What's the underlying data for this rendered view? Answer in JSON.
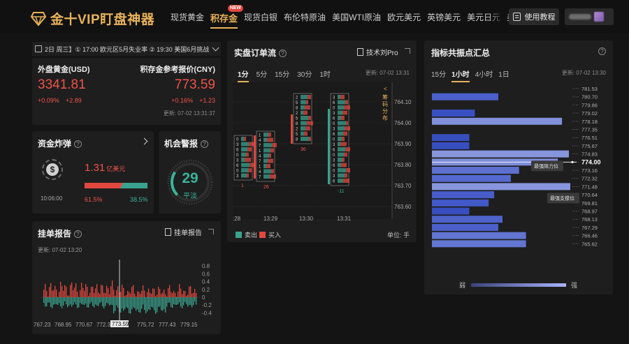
{
  "header": {
    "logo_text": "金十VIP盯盘神器",
    "nav": [
      {
        "label": "现货黄金",
        "active": false
      },
      {
        "label": "积存金",
        "active": true,
        "badge": "NEW"
      },
      {
        "label": "现货白银",
        "active": false
      },
      {
        "label": "布伦特原油",
        "active": false
      },
      {
        "label": "美国WTI原油",
        "active": false
      },
      {
        "label": "欧元美元",
        "active": false
      },
      {
        "label": "英镑美元",
        "active": false
      },
      {
        "label": "美元日元",
        "active": false
      },
      {
        "label": "美",
        "active": false
      }
    ],
    "tutorial_label": "使用教程"
  },
  "ticker": {
    "text": "2日 周三】① 17:00 欧元区5月失业率 ② 19:30 美国6月挑战"
  },
  "prices": {
    "left": {
      "label": "外盘黄金(USD)",
      "price": "3341.81",
      "change_pct": "+0.09%",
      "change": "+2.89"
    },
    "right": {
      "label": "积存金参考报价(CNY)",
      "price": "773.59",
      "change_pct": "+0.16%",
      "change": "+1.23"
    },
    "updated": "更新: 07-02 13:31:37"
  },
  "fund_bomb": {
    "title": "资金炸弹",
    "amount": "1.31",
    "unit": "亿美元",
    "time": "10:06:00",
    "sell_pct": "61.5%",
    "buy_pct": "38.5%",
    "sell_fraction": 0.615
  },
  "alert": {
    "title": "机会警报",
    "value": "29",
    "status": "平淡",
    "level_fraction": 0.29
  },
  "order_report": {
    "title": "挂单报告",
    "button_label": "挂单报告",
    "updated": "更新: 07-02 13:20",
    "x_labels": [
      "767.23",
      "768.95",
      "770.67",
      "772.39",
      "773.59",
      "775.72",
      "777.43",
      "779.15"
    ],
    "y_labels": [
      "0.8",
      "0.6",
      "0.4",
      "0.2",
      "0",
      "-0.2",
      "-0.4"
    ]
  },
  "order_flow": {
    "title": "实盘订单流",
    "pro_label": "技术刘Pro",
    "tabs": [
      "1分",
      "5分",
      "15分",
      "30分",
      "1时"
    ],
    "active_tab": "1分",
    "updated": "更新: 07-02 13:31",
    "side_label": "筹码分布",
    "price_levels": [
      "764.10",
      "764.00",
      "763.90",
      "763.80",
      "763.70",
      "763.60"
    ],
    "time_labels": [
      ":28",
      "13:29",
      "13:30",
      "13:31"
    ],
    "legend_sell": "卖出",
    "legend_buy": "买入",
    "unit_label": "单位: 手",
    "candle_labels": [
      "1",
      "26",
      "36",
      "-11"
    ],
    "colors": {
      "sell": "#3aa38f",
      "buy": "#e2483f"
    }
  },
  "resonance": {
    "title": "指标共振点汇总",
    "tabs": [
      "15分",
      "1小时",
      "4小时",
      "1日"
    ],
    "active_tab": "1小时",
    "updated": "更新: 07-02 13:30",
    "levels": [
      "781.53",
      "780.70",
      "779.86",
      "779.02",
      "778.18",
      "777.35",
      "776.51",
      "775.67",
      "774.83",
      "774.00",
      "773.16",
      "772.32",
      "771.48",
      "770.64",
      "769.81",
      "768.97",
      "768.13",
      "767.29",
      "766.46",
      "765.62"
    ],
    "strengths": [
      0,
      0.48,
      0,
      0.31,
      0.94,
      0,
      0.27,
      0.27,
      0.99,
      0.91,
      0.63,
      0.57,
      1.0,
      0.45,
      0.41,
      0.27,
      0.51,
      0.48,
      0.68,
      0.68
    ],
    "current_level": "774.00",
    "tooltip_resist": "最强阻力位",
    "tooltip_support": "最强支撑位",
    "weak_label": "弱",
    "strong_label": "强"
  }
}
